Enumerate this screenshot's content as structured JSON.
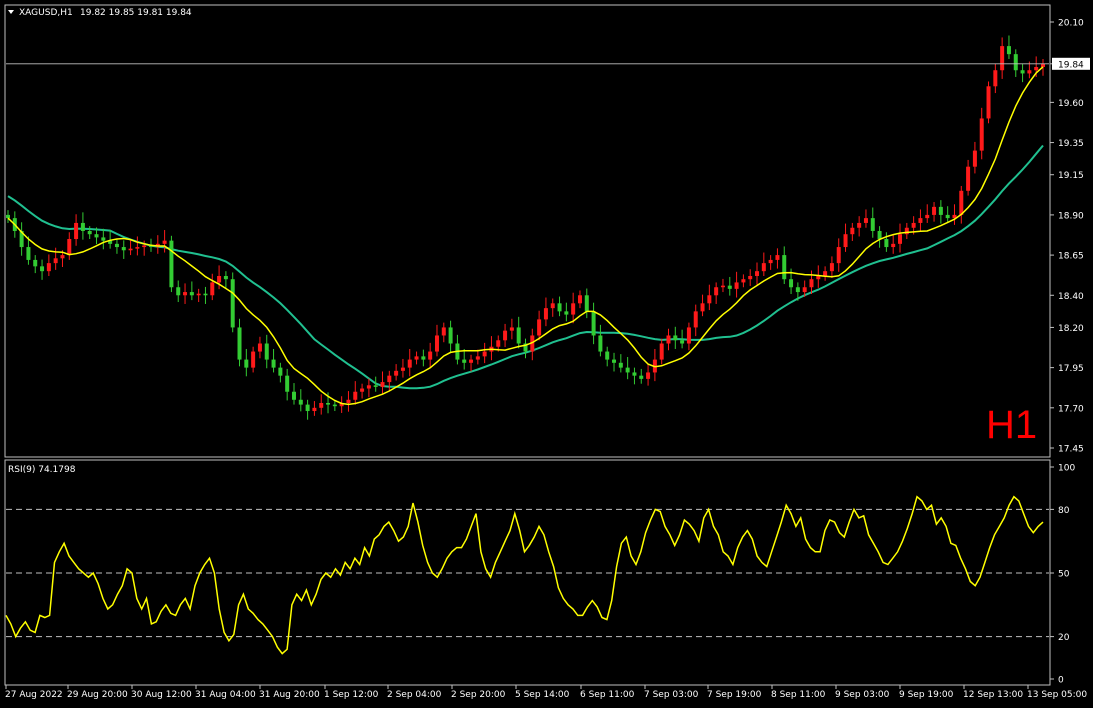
{
  "header": {
    "symbol": "XAGUSD,H1",
    "ohlc": "19.82 19.85 19.81 19.84",
    "menu_icon": "triangle-down-icon"
  },
  "timeframe_label": "H1",
  "current_price_label": "19.84",
  "colors": {
    "background": "#000000",
    "frame": "#c0c0c0",
    "bull": "#ff1a1a",
    "bear": "#33cc33",
    "ma_fast": "#ffff00",
    "ma_slow": "#20c090",
    "rsi": "#ffff00",
    "price_line": "#c0c0c0",
    "timeframe": "#ff0000"
  },
  "chart_data": [
    {
      "type": "candlestick",
      "title": "XAGUSD,H1",
      "ylim": [
        17.45,
        20.2
      ],
      "y_ticks": [
        "20.10",
        "19.84",
        "19.60",
        "19.35",
        "19.15",
        "18.90",
        "18.65",
        "18.40",
        "18.20",
        "17.95",
        "17.70",
        "17.45"
      ],
      "x_ticks": [
        "27 Aug 2022",
        "29 Aug 20:00",
        "30 Aug 12:00",
        "31 Aug 04:00",
        "31 Aug 20:00",
        "1 Sep 12:00",
        "2 Sep 04:00",
        "2 Sep 20:00",
        "5 Sep 14:00",
        "6 Sep 11:00",
        "7 Sep 03:00",
        "7 Sep 19:00",
        "8 Sep 11:00",
        "9 Sep 03:00",
        "9 Sep 19:00",
        "12 Sep 13:00",
        "13 Sep 05:00"
      ],
      "last_price": 19.84,
      "close": [
        18.88,
        18.8,
        18.7,
        18.62,
        18.58,
        18.55,
        18.6,
        18.63,
        18.65,
        18.75,
        18.85,
        18.8,
        18.78,
        18.76,
        18.74,
        18.72,
        18.7,
        18.68,
        18.69,
        18.7,
        18.71,
        18.7,
        18.72,
        18.74,
        18.45,
        18.4,
        18.42,
        18.4,
        18.41,
        18.4,
        18.48,
        18.52,
        18.5,
        18.2,
        18.0,
        17.95,
        18.05,
        18.1,
        18.0,
        17.95,
        17.9,
        17.8,
        17.75,
        17.72,
        17.68,
        17.7,
        17.73,
        17.72,
        17.71,
        17.73,
        17.75,
        17.8,
        17.82,
        17.84,
        17.83,
        17.86,
        17.9,
        17.93,
        17.95,
        18.0,
        18.02,
        18.0,
        18.05,
        18.15,
        18.2,
        18.1,
        18.0,
        17.98,
        18.0,
        18.02,
        18.05,
        18.08,
        18.12,
        18.18,
        18.2,
        18.1,
        18.05,
        18.15,
        18.25,
        18.32,
        18.35,
        18.3,
        18.28,
        18.35,
        18.4,
        18.3,
        18.15,
        18.05,
        18.0,
        17.98,
        17.95,
        17.92,
        17.9,
        17.88,
        17.92,
        18.0,
        18.1,
        18.15,
        18.12,
        18.1,
        18.2,
        18.3,
        18.35,
        18.4,
        18.45,
        18.46,
        18.44,
        18.48,
        18.5,
        18.52,
        18.55,
        18.6,
        18.62,
        18.65,
        18.5,
        18.45,
        18.42,
        18.45,
        18.5,
        18.52,
        18.55,
        18.6,
        18.7,
        18.78,
        18.82,
        18.85,
        18.88,
        18.8,
        18.75,
        18.7,
        18.72,
        18.78,
        18.82,
        18.85,
        18.88,
        18.9,
        18.95,
        18.9,
        18.88,
        18.9,
        19.05,
        19.2,
        19.3,
        19.5,
        19.7,
        19.8,
        19.95,
        19.9,
        19.8,
        19.78,
        19.8,
        19.82,
        19.84
      ],
      "sma_fast": [],
      "sma_slow": []
    },
    {
      "type": "line",
      "title": "RSI(9) 74.1798",
      "ylim": [
        0,
        100
      ],
      "y_ticks": [
        "100",
        "80",
        "50",
        "20",
        "0"
      ],
      "levels": [
        80,
        50,
        20
      ],
      "values": [
        30,
        26,
        20,
        24,
        27,
        23,
        22,
        30,
        29,
        30,
        55,
        60,
        64,
        58,
        55,
        52,
        50,
        48,
        50,
        45,
        38,
        33,
        35,
        40,
        44,
        52,
        50,
        38,
        33,
        38,
        26,
        27,
        32,
        35,
        31,
        30,
        35,
        38,
        33,
        44,
        50,
        54,
        57,
        50,
        33,
        22,
        18,
        21,
        35,
        40,
        33,
        31,
        28,
        26,
        23,
        20,
        15,
        12,
        14,
        35,
        40,
        37,
        42,
        35,
        40,
        47,
        50,
        48,
        52,
        49,
        55,
        52,
        57,
        54,
        62,
        58,
        66,
        68,
        72,
        74,
        70,
        65,
        67,
        72,
        83,
        74,
        63,
        55,
        50,
        48,
        52,
        57,
        60,
        62,
        62,
        66,
        72,
        78,
        60,
        52,
        48,
        55,
        60,
        65,
        70,
        78,
        70,
        60,
        63,
        67,
        72,
        68,
        60,
        53,
        43,
        38,
        35,
        33,
        30,
        30,
        34,
        37,
        34,
        29,
        28,
        37,
        53,
        64,
        67,
        58,
        54,
        60,
        69,
        75,
        80,
        79,
        72,
        68,
        63,
        68,
        75,
        73,
        70,
        65,
        76,
        80,
        72,
        68,
        60,
        58,
        54,
        62,
        67,
        70,
        66,
        58,
        55,
        53,
        60,
        67,
        74,
        82,
        78,
        72,
        76,
        66,
        62,
        60,
        60,
        70,
        75,
        74,
        69,
        67,
        74,
        80,
        76,
        77,
        68,
        64,
        60,
        55,
        54,
        57,
        60,
        65,
        71,
        78,
        86,
        84,
        80,
        82,
        73,
        76,
        72,
        64,
        63,
        57,
        52,
        46,
        44,
        48,
        55,
        62,
        68,
        72,
        76,
        82,
        86,
        84,
        78,
        72,
        69,
        72,
        74
      ]
    }
  ],
  "rsi_label": "RSI(9) 74.1798"
}
